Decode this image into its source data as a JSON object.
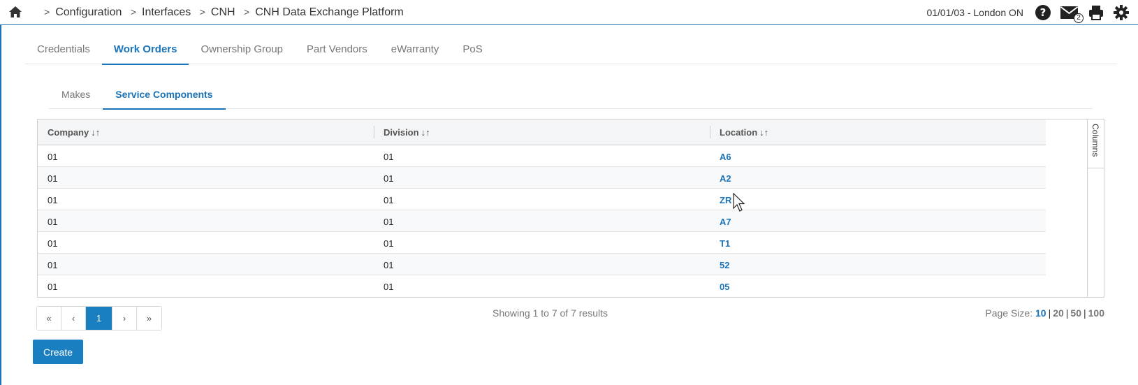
{
  "breadcrumb": {
    "items": [
      "Configuration",
      "Interfaces",
      "CNH",
      "CNH Data Exchange Platform"
    ]
  },
  "header": {
    "date_location": "01/01/03 - London ON",
    "mail_count": "2"
  },
  "icons": {
    "home": "home-icon",
    "help": "help-icon",
    "mail": "mail-icon",
    "print": "print-icon",
    "settings": "gear-icon"
  },
  "tabs": [
    {
      "label": "Credentials",
      "active": false
    },
    {
      "label": "Work Orders",
      "active": true
    },
    {
      "label": "Ownership Group",
      "active": false
    },
    {
      "label": "Part Vendors",
      "active": false
    },
    {
      "label": "eWarranty",
      "active": false
    },
    {
      "label": "PoS",
      "active": false
    }
  ],
  "subtabs": [
    {
      "label": "Makes",
      "active": false
    },
    {
      "label": "Service Components",
      "active": true
    }
  ],
  "table": {
    "columns": [
      "Company",
      "Division",
      "Location"
    ],
    "sort_glyph": "↓↑",
    "columns_toggle": "Columns",
    "rows": [
      [
        "01",
        "01",
        "A6"
      ],
      [
        "01",
        "01",
        "A2"
      ],
      [
        "01",
        "01",
        "ZR"
      ],
      [
        "01",
        "01",
        "A7"
      ],
      [
        "01",
        "01",
        "T1"
      ],
      [
        "01",
        "01",
        "52"
      ],
      [
        "01",
        "01",
        "05"
      ]
    ]
  },
  "pager": {
    "first": "«",
    "prev": "‹",
    "current": "1",
    "next": "›",
    "last": "»",
    "showing": "Showing 1 to 7 of 7 results",
    "page_size_label": "Page Size:",
    "page_sizes": [
      "10",
      "20",
      "50",
      "100"
    ],
    "page_size_selected": "10"
  },
  "actions": {
    "create_label": "Create"
  },
  "colors": {
    "accent": "#1a73b8",
    "button": "#1a7fc1"
  }
}
